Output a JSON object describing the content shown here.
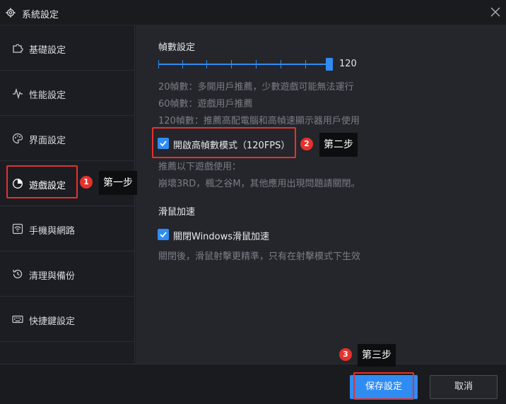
{
  "window": {
    "title": "系統設定",
    "icon": "gear-icon",
    "close_icon": "close-icon"
  },
  "sidebar": {
    "items": [
      {
        "label": "基礎設定",
        "icon": "puzzle-icon"
      },
      {
        "label": "性能設定",
        "icon": "pulse-icon"
      },
      {
        "label": "界面設定",
        "icon": "palette-icon"
      },
      {
        "label": "遊戲設定",
        "icon": "game-icon"
      },
      {
        "label": "手機與網路",
        "icon": "wifi-icon"
      },
      {
        "label": "清理與備份",
        "icon": "history-icon"
      },
      {
        "label": "快捷鍵設定",
        "icon": "keyboard-icon"
      }
    ]
  },
  "frame_rate": {
    "title": "幀數設定",
    "value": "120",
    "level": 1.0,
    "hints": [
      "20幀數：多開用戶推薦，少數遊戲可能無法運行",
      "60幀數：遊戲用戶推薦",
      "120幀數：推薦高配電腦和高幀速顯示器用戶使用"
    ],
    "high_fps_label": "開啟高幀數模式（120FPS）",
    "high_fps_checked": true,
    "recommend_title": "推薦以下遊戲使用：",
    "recommend_games": "崩壞3RD，楓之谷M，其他應用出現問題請關閉。"
  },
  "mouse": {
    "title": "滑鼠加速",
    "disable_label": "關閉Windows滑鼠加速",
    "disable_checked": true,
    "hint": "關閉後，滑鼠射擊更精準，只有在射擊模式下生效"
  },
  "annotations": {
    "step1": {
      "number": "1",
      "label": "第一步"
    },
    "step2": {
      "number": "2",
      "label": "第二步"
    },
    "step3": {
      "number": "3",
      "label": "第三步"
    },
    "highlight_color": "#e5322d"
  },
  "footer": {
    "save_label": "保存設定",
    "cancel_label": "取消"
  },
  "colors": {
    "accent": "#2f8cf3",
    "background": "#24262b",
    "sidebar": "#1b1d22"
  }
}
